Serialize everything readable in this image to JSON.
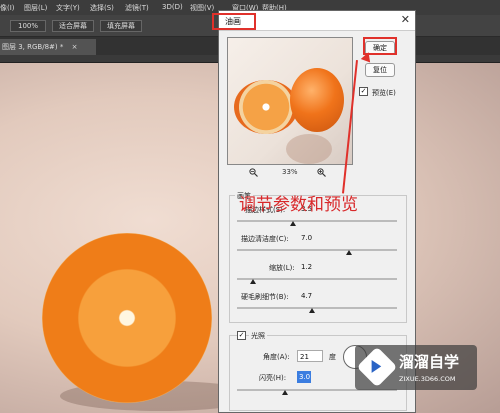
{
  "menubar": {
    "items": [
      "像(I)",
      "图层(L)",
      "文字(Y)",
      "选择(S)",
      "滤镜(T)",
      "3D(D)",
      "视图(V)",
      "窗口(W)",
      "帮助(H)"
    ]
  },
  "options_bar": {
    "zoom_label": "100%",
    "fit_screen_label": "适合屏幕",
    "fill_screen_label": "填充屏幕"
  },
  "document_tab": {
    "label": "图层 3, RGB/8#) *",
    "close": "×"
  },
  "dialog": {
    "title": "油画",
    "close_glyph": "✕",
    "ok_label": "确定",
    "reset_label": "复位",
    "preview_label": "预览(E)",
    "preview_checked": true,
    "zoom_out_icon": "zoom-out-icon",
    "zoom_in_icon": "zoom-in-icon",
    "zoom_value": "33%",
    "brush": {
      "group_label": "画笔",
      "stylization_label": "描边样式(S):",
      "stylization_value": "3.5",
      "stylization_level": 0.35,
      "cleanliness_label": "描边清洁度(C):",
      "cleanliness_value": "7.0",
      "cleanliness_level": 0.7,
      "scale_label": "缩放(L):",
      "scale_value": "1.2",
      "scale_level": 0.1,
      "bristle_label": "硬毛刷细节(B):",
      "bristle_value": "4.7",
      "bristle_level": 0.47
    },
    "lighting": {
      "group_label": "光照",
      "checked": true,
      "angle_label": "角度(A):",
      "angle_value": "21",
      "angle_unit": "度",
      "shine_label": "闪亮(H):",
      "shine_value": "3.0",
      "shine_level": 0.3
    }
  },
  "annotation": {
    "text": "调节参数和预览"
  },
  "watermark": {
    "title": "溜溜自学",
    "subtitle": "ZIXUE.3D66.COM"
  },
  "colors": {
    "accent_red": "#e0312b",
    "selection_blue": "#3b7de0"
  }
}
